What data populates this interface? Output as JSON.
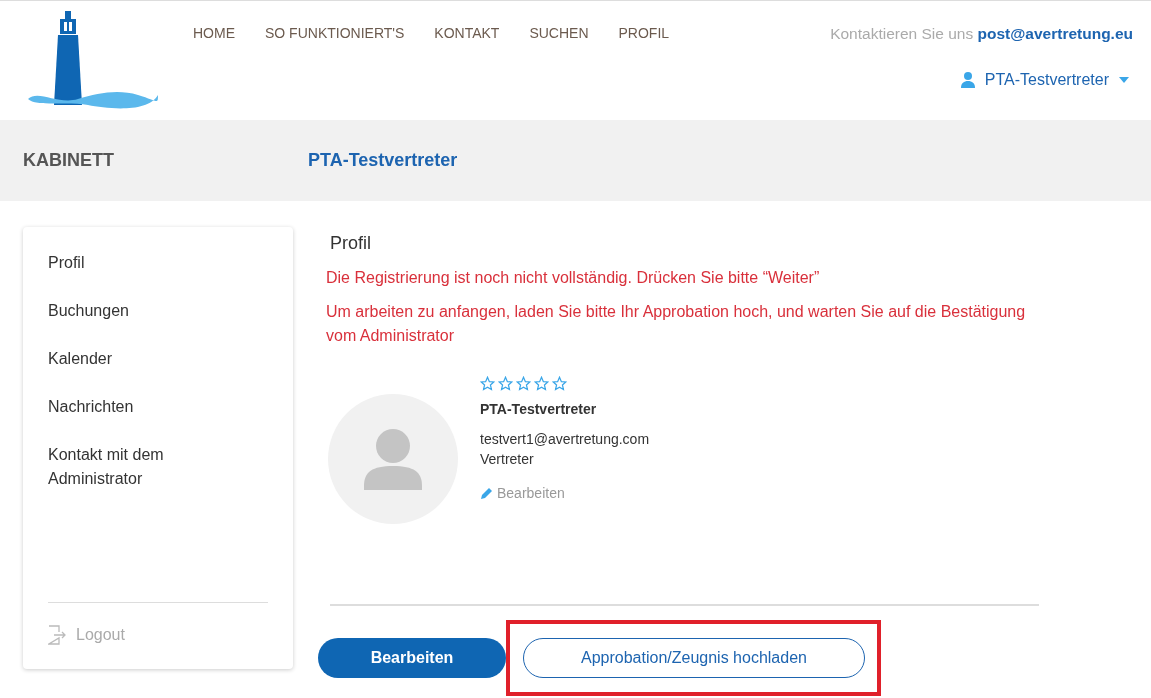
{
  "header": {
    "nav": [
      {
        "label": "HOME"
      },
      {
        "label": "SO FUNKTIONIERT'S"
      },
      {
        "label": "KONTAKT"
      },
      {
        "label": "SUCHEN"
      },
      {
        "label": "PROFIL"
      }
    ],
    "contact_text": "Kontaktieren Sie uns",
    "contact_email": "post@avertretung.eu",
    "user_menu": "PTA-Testvertreter"
  },
  "band": {
    "title": "KABINETT",
    "subtitle": "PTA-Testvertreter"
  },
  "sidebar": {
    "items": [
      {
        "label": "Profil"
      },
      {
        "label": "Buchungen"
      },
      {
        "label": "Kalender"
      },
      {
        "label": "Nachrichten"
      },
      {
        "label": "Kontakt mit dem Administrator"
      }
    ],
    "logout": "Logout"
  },
  "profile": {
    "heading": "Profil",
    "warnings": [
      "Die Registrierung ist noch nicht vollständig. Drücken Sie bitte “Weiter”",
      "Um arbeiten zu anfangen, laden Sie bitte Ihr Approbation hoch, und warten Sie auf die Bestätigung vom Administrator"
    ],
    "stars": 0,
    "name": "PTA-Testvertreter",
    "email": "testvert1@avertretung.com",
    "role": "Vertreter",
    "edit_link": "Bearbeiten"
  },
  "buttons": [
    {
      "label": "Bearbeiten",
      "kind": "primary",
      "highlighted": false
    },
    {
      "label": "Approbation/Zeugnis hochladen",
      "kind": "outline",
      "highlighted": true
    }
  ]
}
